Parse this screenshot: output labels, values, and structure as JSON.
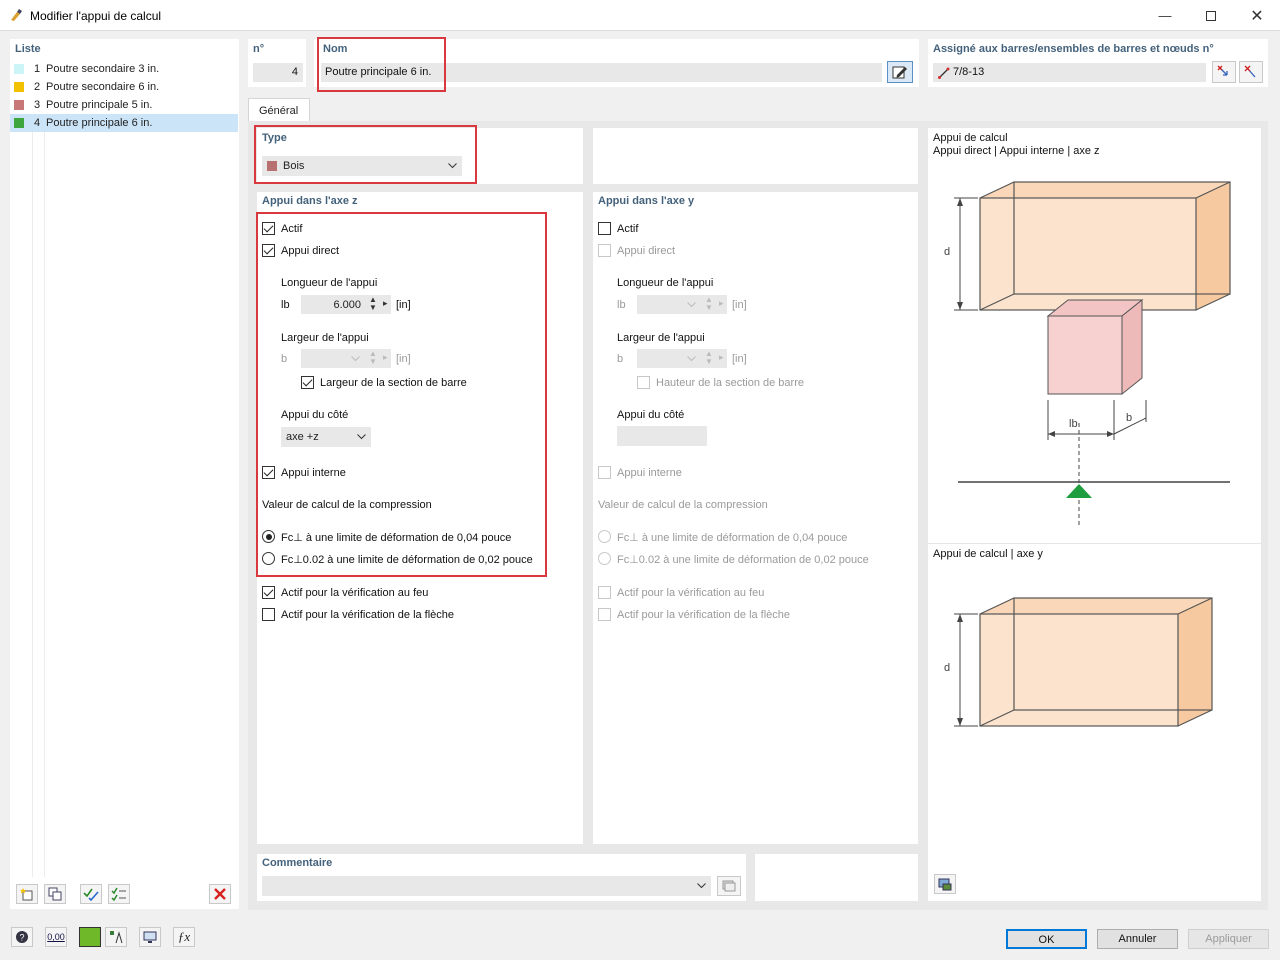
{
  "window": {
    "title": "Modifier l'appui de calcul"
  },
  "list": {
    "header": "Liste",
    "items": [
      {
        "no": "1",
        "name": "Poutre secondaire 3 in.",
        "color": "#ccf5f8"
      },
      {
        "no": "2",
        "name": "Poutre secondaire 6 in.",
        "color": "#f2c200"
      },
      {
        "no": "3",
        "name": "Poutre principale 5 in.",
        "color": "#c87878"
      },
      {
        "no": "4",
        "name": "Poutre principale 6 in.",
        "color": "#3da63d"
      }
    ]
  },
  "header": {
    "no_label": "n°",
    "no_value": "4",
    "name_label": "Nom",
    "name_value": "Poutre principale 6 in.",
    "assigned_label": "Assigné aux barres/ensembles de barres et nœuds n°",
    "assigned_value": "7/8-13"
  },
  "tabs": [
    {
      "label": "Général"
    }
  ],
  "type": {
    "label": "Type",
    "value": "Bois",
    "color": "#b87070"
  },
  "z": {
    "header": "Appui dans l'axe z",
    "active": "Actif",
    "direct": "Appui direct",
    "length_label": "Longueur de l'appui",
    "length_sym": "lb",
    "length_value": "6.000",
    "unit": "[in]",
    "width_label": "Largeur de l'appui",
    "width_sym": "b",
    "width_value": "",
    "width_unit": "[in]",
    "width_section": "Largeur de la section de barre",
    "side_label": "Appui du côté",
    "side_value": "axe +z",
    "internal": "Appui interne",
    "compression_label": "Valeur de calcul de la compression",
    "opt1": "Fc⊥ à une limite de déformation de 0,04 pouce",
    "opt2": "Fc⊥0.02 à une limite de déformation de 0,02 pouce",
    "fire": "Actif pour la vérification au feu",
    "deflection": "Actif pour la vérification de la flèche"
  },
  "y": {
    "header": "Appui dans l'axe y",
    "active": "Actif",
    "direct": "Appui direct",
    "length_label": "Longueur de l'appui",
    "length_sym": "lb",
    "unit": "[in]",
    "width_label": "Largeur de l'appui",
    "width_sym": "b",
    "width_unit": "[in]",
    "height_section": "Hauteur de la section de barre",
    "side_label": "Appui du côté",
    "internal": "Appui interne",
    "compression_label": "Valeur de calcul de la compression",
    "opt1": "Fc⊥ à une limite de déformation de 0,04 pouce",
    "opt2": "Fc⊥0.02 à une limite de déformation de 0,02 pouce",
    "fire": "Actif pour la vérification au feu",
    "deflection": "Actif pour la vérification de la flèche"
  },
  "diagram": {
    "title1": "Appui de calcul",
    "subtitle1": "Appui direct | Appui interne | axe z",
    "title2": "Appui de calcul | axe y",
    "d": "d",
    "lb": "lb",
    "b": "b"
  },
  "comment": {
    "label": "Commentaire",
    "value": ""
  },
  "buttons": {
    "ok": "OK",
    "cancel": "Annuler",
    "apply": "Appliquer"
  },
  "status_icons": {
    "numeric": "0,00"
  }
}
